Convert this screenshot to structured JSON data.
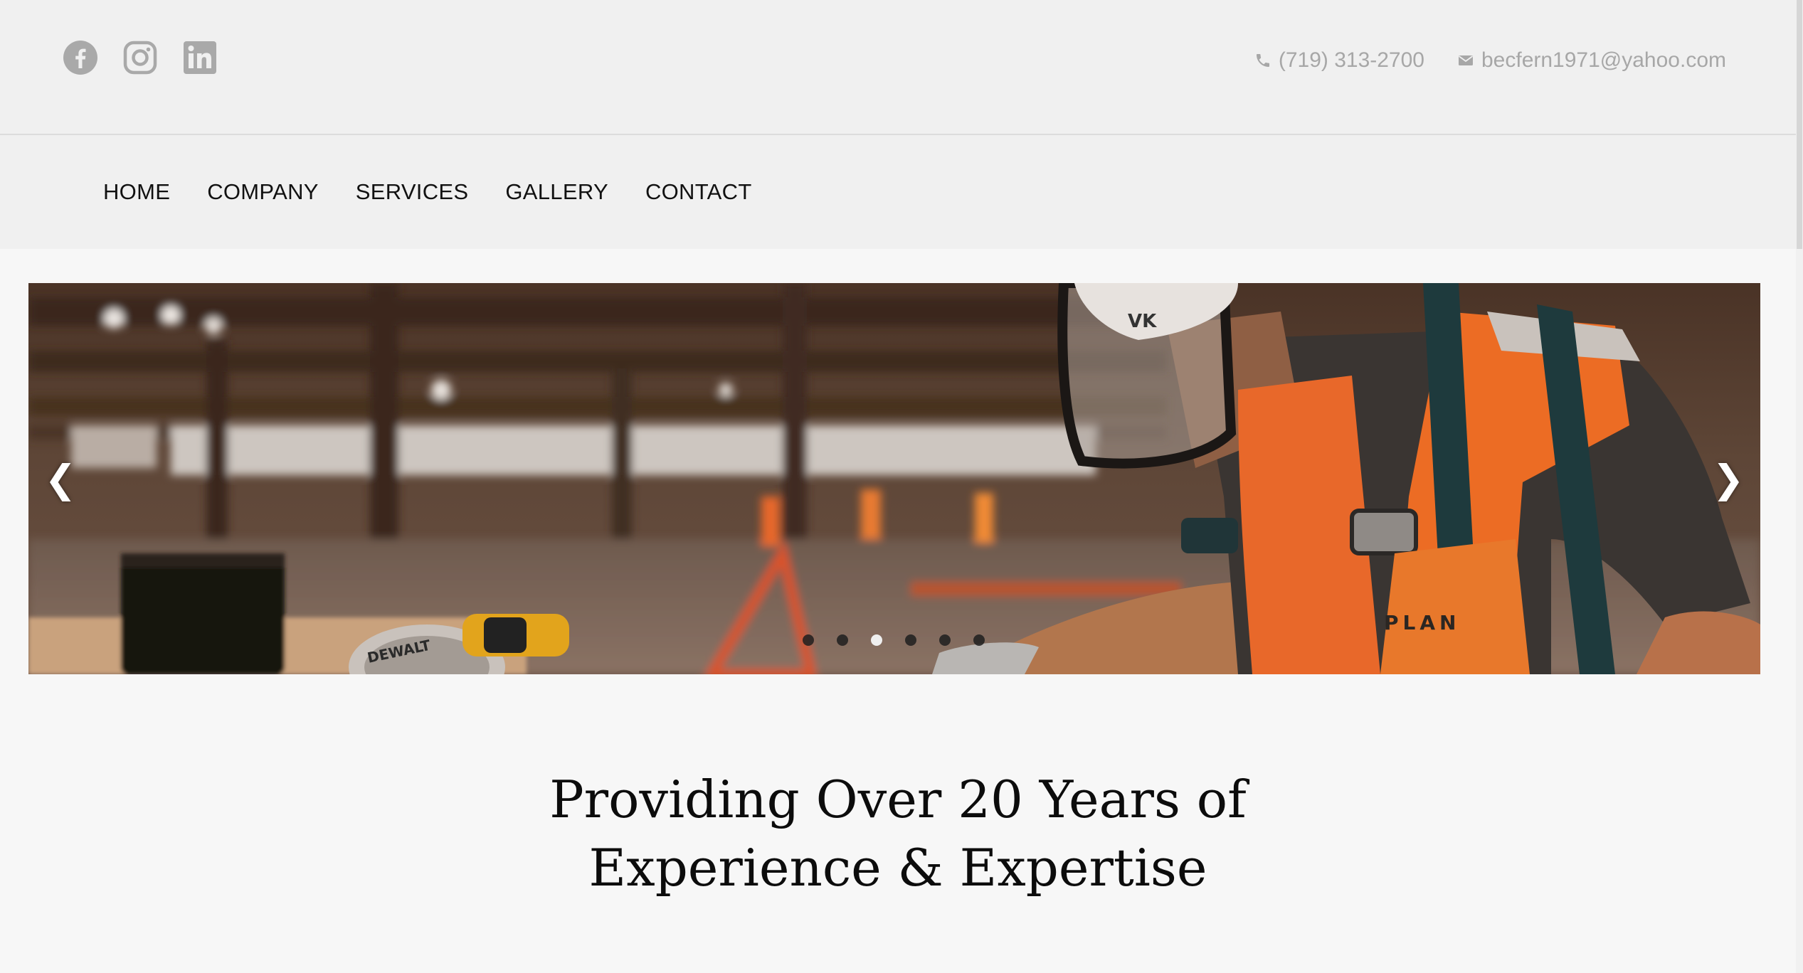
{
  "topbar": {
    "social": [
      "facebook-icon",
      "instagram-icon",
      "linkedin-icon"
    ],
    "phone": "(719) 313-2700",
    "email": "becfern1971@yahoo.com"
  },
  "nav": {
    "items": [
      "HOME",
      "COMPANY",
      "SERVICES",
      "GALLERY",
      "CONTACT"
    ]
  },
  "slider": {
    "prev_label": "❮",
    "next_label": "❯",
    "slide_count": 6,
    "active_slide": 3,
    "visible_text": {
      "saw_brand": "DEWALT",
      "bag_text": "PLAN"
    }
  },
  "hero": {
    "line1": "Providing Over 20 Years of",
    "line2": "Experience & Expertise"
  },
  "colors": {
    "topbar_bg": "#f0f0f0",
    "page_bg": "#f7f7f7",
    "muted_text": "#a7a7a7",
    "nav_text": "#111111"
  }
}
